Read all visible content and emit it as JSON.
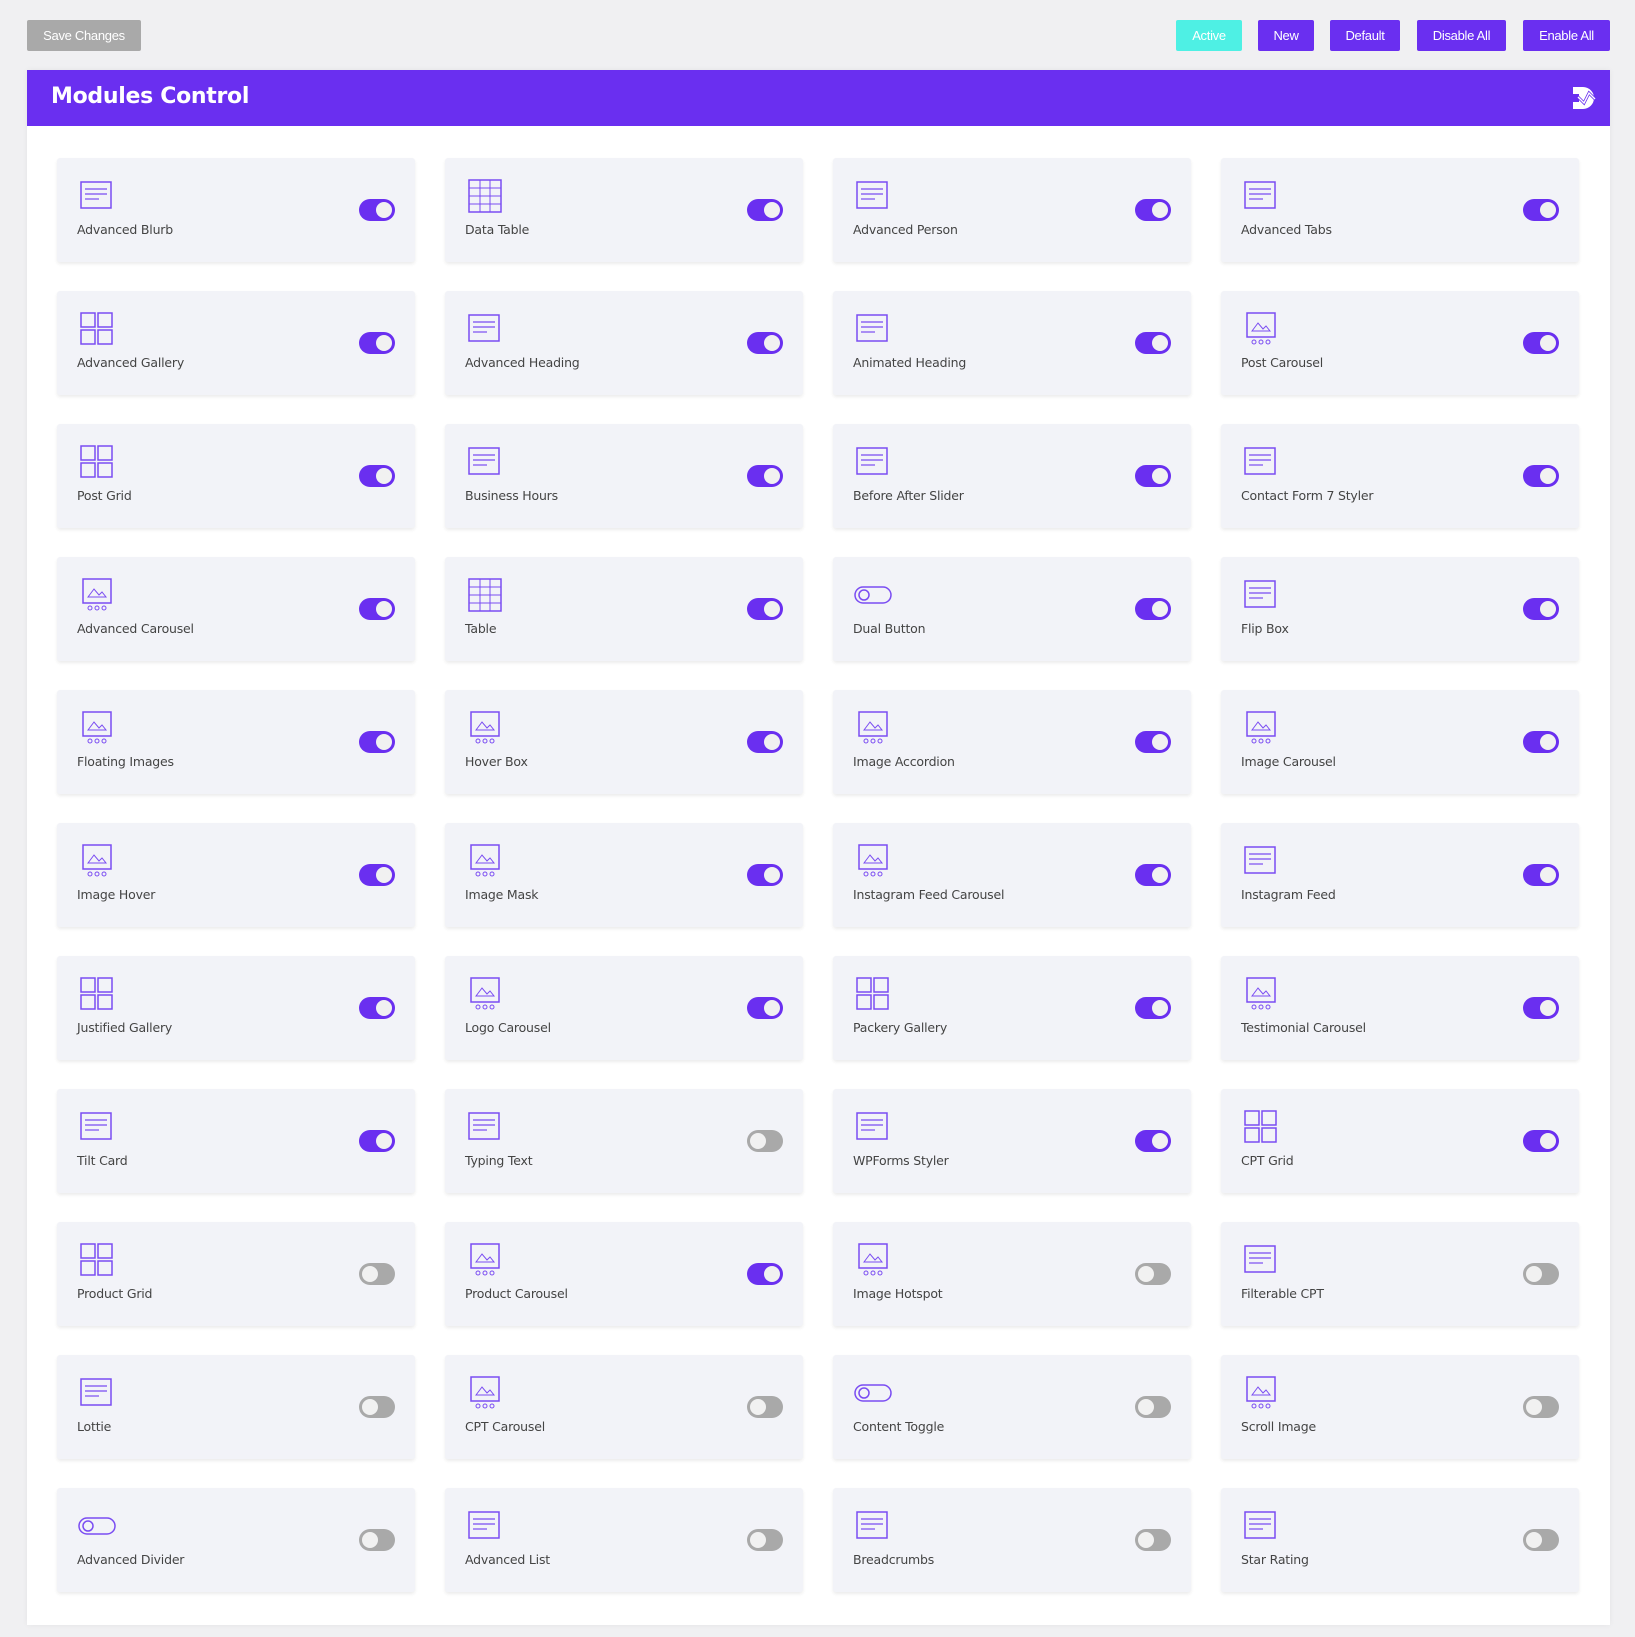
{
  "toolbar": {
    "save_label": "Save Changes",
    "filters": [
      {
        "label": "Active",
        "state": "selected"
      },
      {
        "label": "New",
        "state": "default"
      },
      {
        "label": "Default",
        "state": "default"
      },
      {
        "label": "Disable All",
        "state": "default"
      },
      {
        "label": "Enable All",
        "state": "default"
      }
    ]
  },
  "panel": {
    "title": "Modules Control",
    "logo_icon": "brand-logo-icon"
  },
  "colors": {
    "accent": "#6a2ff0",
    "active_filter": "#4ef0e4",
    "toggle_off": "#a9a9a9",
    "card_bg": "#f2f3f8"
  },
  "modules": [
    {
      "label": "Advanced Blurb",
      "icon": "blurb-icon",
      "enabled": true
    },
    {
      "label": "Data Table",
      "icon": "data-table-icon",
      "enabled": true
    },
    {
      "label": "Advanced Person",
      "icon": "person-icon",
      "enabled": true
    },
    {
      "label": "Advanced Tabs",
      "icon": "tabs-icon",
      "enabled": true
    },
    {
      "label": "Advanced Gallery",
      "icon": "gallery-icon",
      "enabled": true
    },
    {
      "label": "Advanced Heading",
      "icon": "heading-icon",
      "enabled": true
    },
    {
      "label": "Animated Heading",
      "icon": "animated-heading-icon",
      "enabled": true
    },
    {
      "label": "Post Carousel",
      "icon": "post-carousel-icon",
      "enabled": true
    },
    {
      "label": "Post Grid",
      "icon": "post-grid-icon",
      "enabled": true
    },
    {
      "label": "Business Hours",
      "icon": "business-hours-icon",
      "enabled": true
    },
    {
      "label": "Before After Slider",
      "icon": "before-after-icon",
      "enabled": true
    },
    {
      "label": "Contact Form 7 Styler",
      "icon": "contact-form-icon",
      "enabled": true
    },
    {
      "label": "Advanced Carousel",
      "icon": "carousel-icon",
      "enabled": true
    },
    {
      "label": "Table",
      "icon": "table-icon",
      "enabled": true
    },
    {
      "label": "Dual Button",
      "icon": "dual-button-icon",
      "enabled": true
    },
    {
      "label": "Flip Box",
      "icon": "flip-box-icon",
      "enabled": true
    },
    {
      "label": "Floating Images",
      "icon": "floating-images-icon",
      "enabled": true
    },
    {
      "label": "Hover Box",
      "icon": "hover-box-icon",
      "enabled": true
    },
    {
      "label": "Image Accordion",
      "icon": "image-accordion-icon",
      "enabled": true
    },
    {
      "label": "Image Carousel",
      "icon": "image-carousel-icon",
      "enabled": true
    },
    {
      "label": "Image Hover",
      "icon": "image-hover-icon",
      "enabled": true
    },
    {
      "label": "Image Mask",
      "icon": "image-mask-icon",
      "enabled": true
    },
    {
      "label": "Instagram Feed Carousel",
      "icon": "instagram-carousel-icon",
      "enabled": true
    },
    {
      "label": "Instagram Feed",
      "icon": "instagram-feed-icon",
      "enabled": true
    },
    {
      "label": "Justified Gallery",
      "icon": "justified-gallery-icon",
      "enabled": true
    },
    {
      "label": "Logo Carousel",
      "icon": "logo-carousel-icon",
      "enabled": true
    },
    {
      "label": "Packery Gallery",
      "icon": "packery-gallery-icon",
      "enabled": true
    },
    {
      "label": "Testimonial Carousel",
      "icon": "testimonial-carousel-icon",
      "enabled": true
    },
    {
      "label": "Tilt Card",
      "icon": "tilt-card-icon",
      "enabled": true
    },
    {
      "label": "Typing Text",
      "icon": "typing-text-icon",
      "enabled": false
    },
    {
      "label": "WPForms Styler",
      "icon": "wpforms-icon",
      "enabled": true
    },
    {
      "label": "CPT Grid",
      "icon": "cpt-grid-icon",
      "enabled": true
    },
    {
      "label": "Product Grid",
      "icon": "product-grid-icon",
      "enabled": false
    },
    {
      "label": "Product Carousel",
      "icon": "product-carousel-icon",
      "enabled": true
    },
    {
      "label": "Image Hotspot",
      "icon": "image-hotspot-icon",
      "enabled": false
    },
    {
      "label": "Filterable CPT",
      "icon": "filterable-cpt-icon",
      "enabled": false
    },
    {
      "label": "Lottie",
      "icon": "lottie-icon",
      "enabled": false
    },
    {
      "label": "CPT Carousel",
      "icon": "cpt-carousel-icon",
      "enabled": false
    },
    {
      "label": "Content Toggle",
      "icon": "content-toggle-icon",
      "enabled": false
    },
    {
      "label": "Scroll Image",
      "icon": "scroll-image-icon",
      "enabled": false
    },
    {
      "label": "Advanced Divider",
      "icon": "divider-icon",
      "enabled": false
    },
    {
      "label": "Advanced List",
      "icon": "list-icon",
      "enabled": false
    },
    {
      "label": "Breadcrumbs",
      "icon": "breadcrumbs-icon",
      "enabled": false
    },
    {
      "label": "Star Rating",
      "icon": "star-rating-icon",
      "enabled": false
    }
  ]
}
